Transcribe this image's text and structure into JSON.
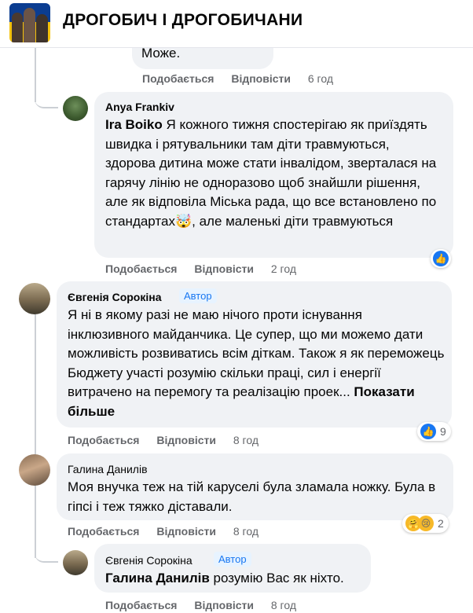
{
  "header": {
    "title": "ДРОГОБИЧ І ДРОГОБИЧАНИ"
  },
  "top_comment": {
    "text_tail": "Може.",
    "like_label": "Подобається",
    "reply_label": "Відповісти",
    "time": "6 год"
  },
  "comment_anya": {
    "author": "Anya Frankiv",
    "mention": "Ira Boiko",
    "text": " Я кожного тижня спостерігаю як приїздять швидка і рятувальники там діти травмуються, здорова дитина може стати інвалідом, зверталася на гарячу лінію не одноразово щоб знайшли рішення, але як відповіла Міська рада, що все встановлено по стандартах",
    "emoji": "🤯",
    "text_end": ", але маленькі діти травмуються",
    "like_label": "Подобається",
    "reply_label": "Відповісти",
    "time": "2 год"
  },
  "comment_evgenia": {
    "author": "Євгенія Сорокіна",
    "badge": "Автор",
    "text": "Я ні в якому разі не маю нічого проти існування інклюзивного майданчика. Це супер, що ми можемо дати можливість розвиватись всім діткам. Також я як переможець Бюджету участі розумію скільки праці, сил і енергії витрачено на перемогу та реалізацію проек...",
    "see_more": "Показати більше",
    "like_label": "Подобається",
    "reply_label": "Відповісти",
    "time": "8 год",
    "reaction_count": "9"
  },
  "comment_halyna": {
    "author": "Галина Данилів",
    "text": "Моя внучка теж на тій каруселі була зламала ножку. Була в гіпсі і теж тяжко діставали.",
    "like_label": "Подобається",
    "reply_label": "Відповісти",
    "time": "8 год",
    "reaction_count": "2"
  },
  "reply_evgenia": {
    "author": "Євгенія Сорокіна",
    "badge": "Автор",
    "mention": "Галина Данилів",
    "text": " розумію Вас як ніхто.",
    "like_label": "Подобається",
    "reply_label": "Відповісти",
    "time": "8 год"
  },
  "icons": {
    "like": "like-icon",
    "wow": "wow-emoji-icon",
    "care": "care-emoji-icon",
    "sad": "sad-emoji-icon",
    "mind_blown": "mind-blown-emoji"
  },
  "colors": {
    "accent": "#1877f2",
    "bubble": "#f0f2f5",
    "meta": "#65676b"
  }
}
